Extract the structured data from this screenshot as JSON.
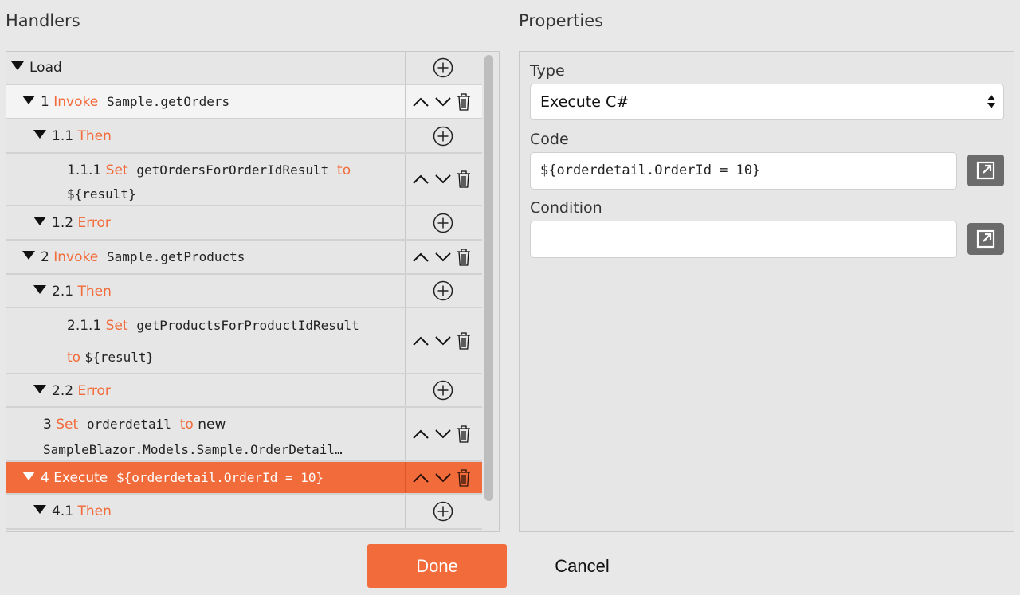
{
  "handlers_title": "Handlers",
  "properties_title": "Properties",
  "tree": {
    "load": {
      "label": "Load"
    },
    "r1": {
      "num": "1",
      "kw": "Invoke",
      "code": "Sample.getOrders"
    },
    "r1_1": {
      "num": "1.1",
      "kw": "Then"
    },
    "r1_1_1": {
      "num": "1.1.1",
      "kw": "Set",
      "code": "getOrdersForOrderIdResult",
      "kw2": "to",
      "code2": "${result}"
    },
    "r1_2": {
      "num": "1.2",
      "kw": "Error"
    },
    "r2": {
      "num": "2",
      "kw": "Invoke",
      "code": "Sample.getProducts"
    },
    "r2_1": {
      "num": "2.1",
      "kw": "Then"
    },
    "r2_1_1": {
      "num": "2.1.1",
      "kw": "Set",
      "code": "getProductsForProductIdResult",
      "kw2": "to",
      "code2": "${result}"
    },
    "r2_2": {
      "num": "2.2",
      "kw": "Error"
    },
    "r3": {
      "num": "3",
      "kw": "Set",
      "code": "orderdetail",
      "kw2": "to",
      "text2": "new",
      "code2": "SampleBlazor.Models.Sample.OrderDetail…"
    },
    "r4": {
      "num": "4",
      "kw": "Execute",
      "code": "${orderdetail.OrderId = 10}"
    },
    "r4_1": {
      "num": "4.1",
      "kw": "Then"
    }
  },
  "properties": {
    "type_label": "Type",
    "type_value": "Execute C#",
    "code_label": "Code",
    "code_value": "${orderdetail.OrderId = 10}",
    "condition_label": "Condition",
    "condition_value": ""
  },
  "footer": {
    "done_label": "Done",
    "cancel_label": "Cancel"
  },
  "colors": {
    "accent": "#f26b3a",
    "background": "#e8e8e8",
    "external_button": "#6b6b6b"
  }
}
